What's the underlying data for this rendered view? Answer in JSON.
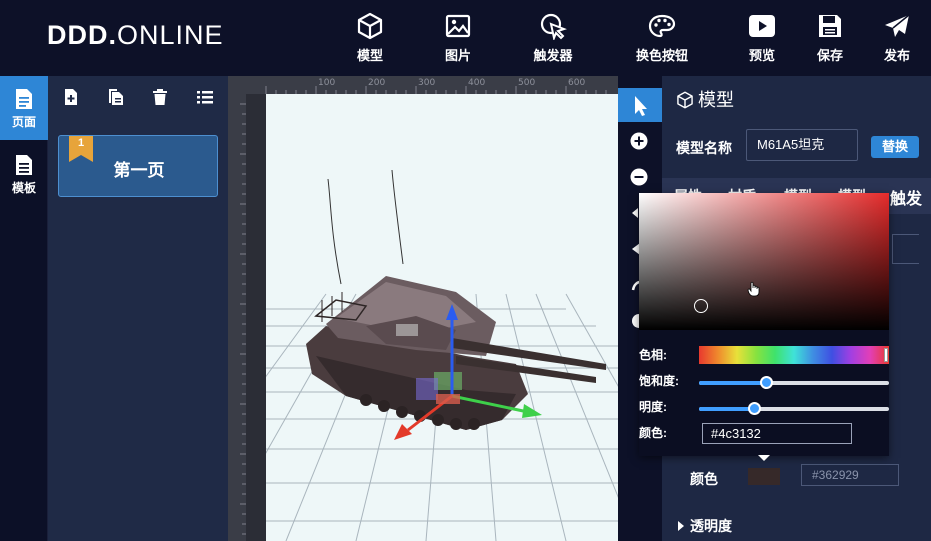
{
  "app": {
    "logo_bold": "DDD.",
    "logo_light": "ONLINE"
  },
  "toolbar": [
    {
      "id": "model",
      "label": "模型",
      "icon": "cube-icon"
    },
    {
      "id": "image",
      "label": "图片",
      "icon": "image-icon"
    },
    {
      "id": "trigger",
      "label": "触发器",
      "icon": "cursor-click-icon"
    },
    {
      "id": "color-button",
      "label": "换色按钮",
      "icon": "palette-icon"
    },
    {
      "id": "preview",
      "label": "预览",
      "icon": "play-icon"
    },
    {
      "id": "save",
      "label": "保存",
      "icon": "floppy-icon"
    },
    {
      "id": "publish",
      "label": "发布",
      "icon": "paper-plane-icon"
    }
  ],
  "rail": [
    {
      "label": "页面",
      "icon": "page-icon",
      "active": true
    },
    {
      "label": "模板",
      "icon": "template-icon",
      "active": false
    }
  ],
  "pages": {
    "tools": [
      "add-page-icon",
      "copy-page-icon",
      "delete-icon",
      "list-icon"
    ],
    "items": [
      {
        "number": "1",
        "title": "第一页"
      }
    ]
  },
  "ruler": {
    "marks": [
      "100",
      "200",
      "300",
      "400",
      "500",
      "600"
    ]
  },
  "props": {
    "header": "模型",
    "name_label": "模型名称",
    "name_value": "M61A5坦克",
    "swap_label": "替换",
    "tabs": [
      "属性",
      "材质",
      "模型",
      "模型",
      "触发"
    ],
    "color_label": "颜色",
    "color_hex": "#362929",
    "opacity_label": "透明度"
  },
  "picker": {
    "hue_label": "色相:",
    "saturation_label": "饱和度:",
    "brightness_label": "明度:",
    "color_label": "颜色:",
    "hex_value": "#4c3132",
    "saturation": 0.35,
    "brightness": 0.29
  },
  "colors": {
    "accent": "#2e86d6",
    "topbar": "#0d1128",
    "panel": "#1e2844",
    "stage": "#eef7f8"
  }
}
